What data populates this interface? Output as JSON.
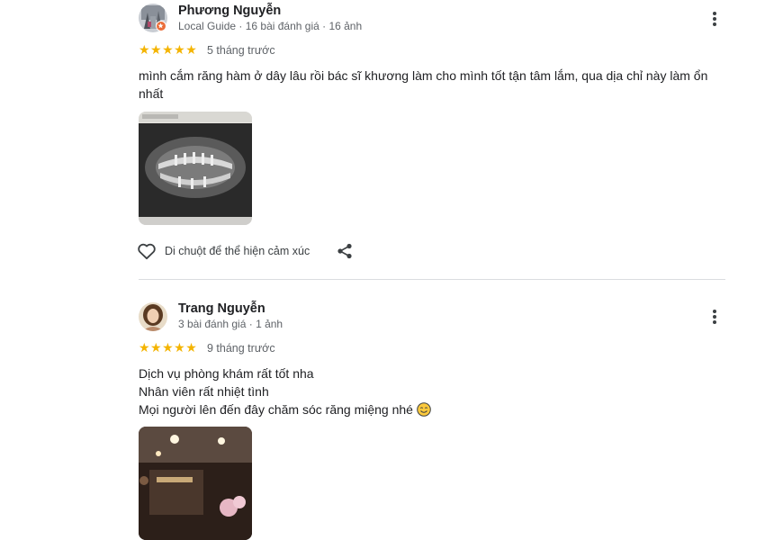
{
  "reviews": [
    {
      "name": "Phương Nguyễn",
      "meta": "Local Guide · 16 bài đánh giá · 16 ảnh",
      "rating": 5,
      "stars": "★★★★★",
      "time": "5 tháng trước",
      "text_lines": [
        "mình cắm răng hàm ở dây lâu rồi bác sĩ khương làm cho mình tốt tận tâm lắm, qua dịa chỉ này làm ổn",
        "nhất"
      ],
      "photo": "panoramic dental x-ray on monitor",
      "like_label": "Di chuột để thể hiện cảm xúc"
    },
    {
      "name": "Trang Nguyễn",
      "meta": "3 bài đánh giá · 1 ảnh",
      "rating": 5,
      "stars": "★★★★★",
      "time": "9 tháng trước",
      "text_lines": [
        "Dịch vụ phòng khám rất tốt nha",
        "Nhân viên rất nhiệt tình",
        "Mọi người lên đến đây chăm sóc răng miệng nhé"
      ],
      "photo": "clinic reception interior"
    }
  ],
  "icons": {
    "more": "more-vert-icon",
    "like": "heart-outline-icon",
    "share": "share-icon",
    "badge": "local-guide-badge-icon",
    "emoji": "smiling-face-emoji"
  },
  "colors": {
    "star": "#f4b400",
    "divider": "#dadce0",
    "meta": "#5f6368",
    "badge": "#ea6d3a"
  }
}
